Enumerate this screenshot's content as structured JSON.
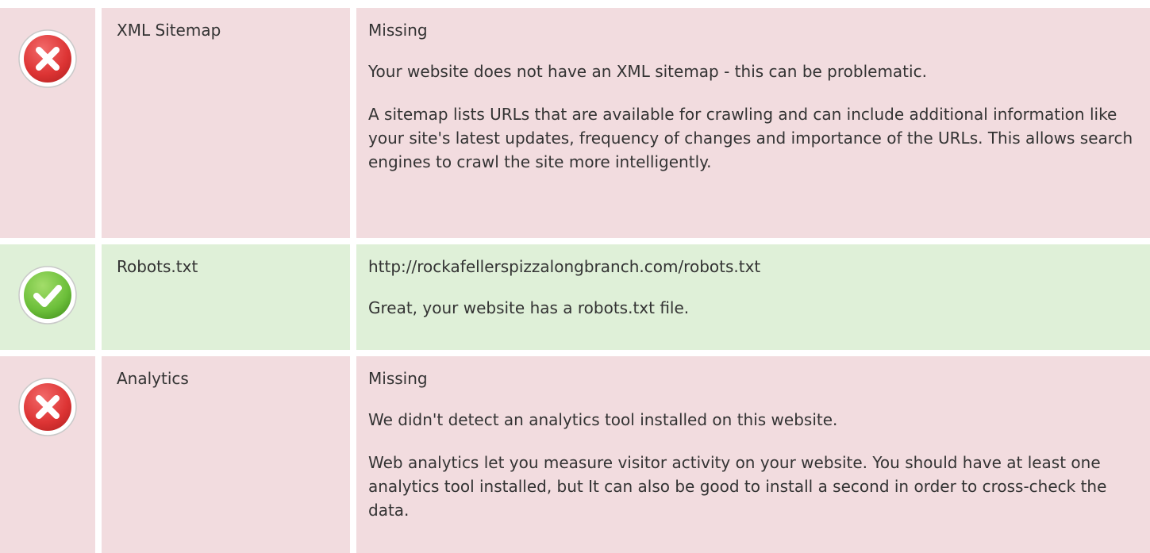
{
  "rows": [
    {
      "status": "fail",
      "icon": "error-icon",
      "label": "XML Sitemap",
      "value": "Missing",
      "summary": "Your website does not have an XML sitemap - this can be problematic.",
      "detail": "A sitemap lists URLs that are available for crawling and can include additional information like your site's latest updates, frequency of changes and importance of the URLs. This allows search engines to crawl the site more intelligently."
    },
    {
      "status": "pass",
      "icon": "check-icon",
      "label": "Robots.txt",
      "value": "http://rockafellerspizzalongbranch.com/robots.txt",
      "summary": "Great, your website has a robots.txt file."
    },
    {
      "status": "fail",
      "icon": "error-icon",
      "label": "Analytics",
      "value": "Missing",
      "summary": "We didn't detect an analytics tool installed on this website.",
      "detail": "Web analytics let you measure visitor activity on your website. You should have at least one analytics tool installed, but It can also be good to install a second in order to cross-check the data."
    }
  ],
  "colors": {
    "fail_bg": "#f2dcdf",
    "pass_bg": "#dff0d8",
    "error_red": "#e0383a",
    "success_green": "#6cbf3a",
    "text": "#333333"
  }
}
